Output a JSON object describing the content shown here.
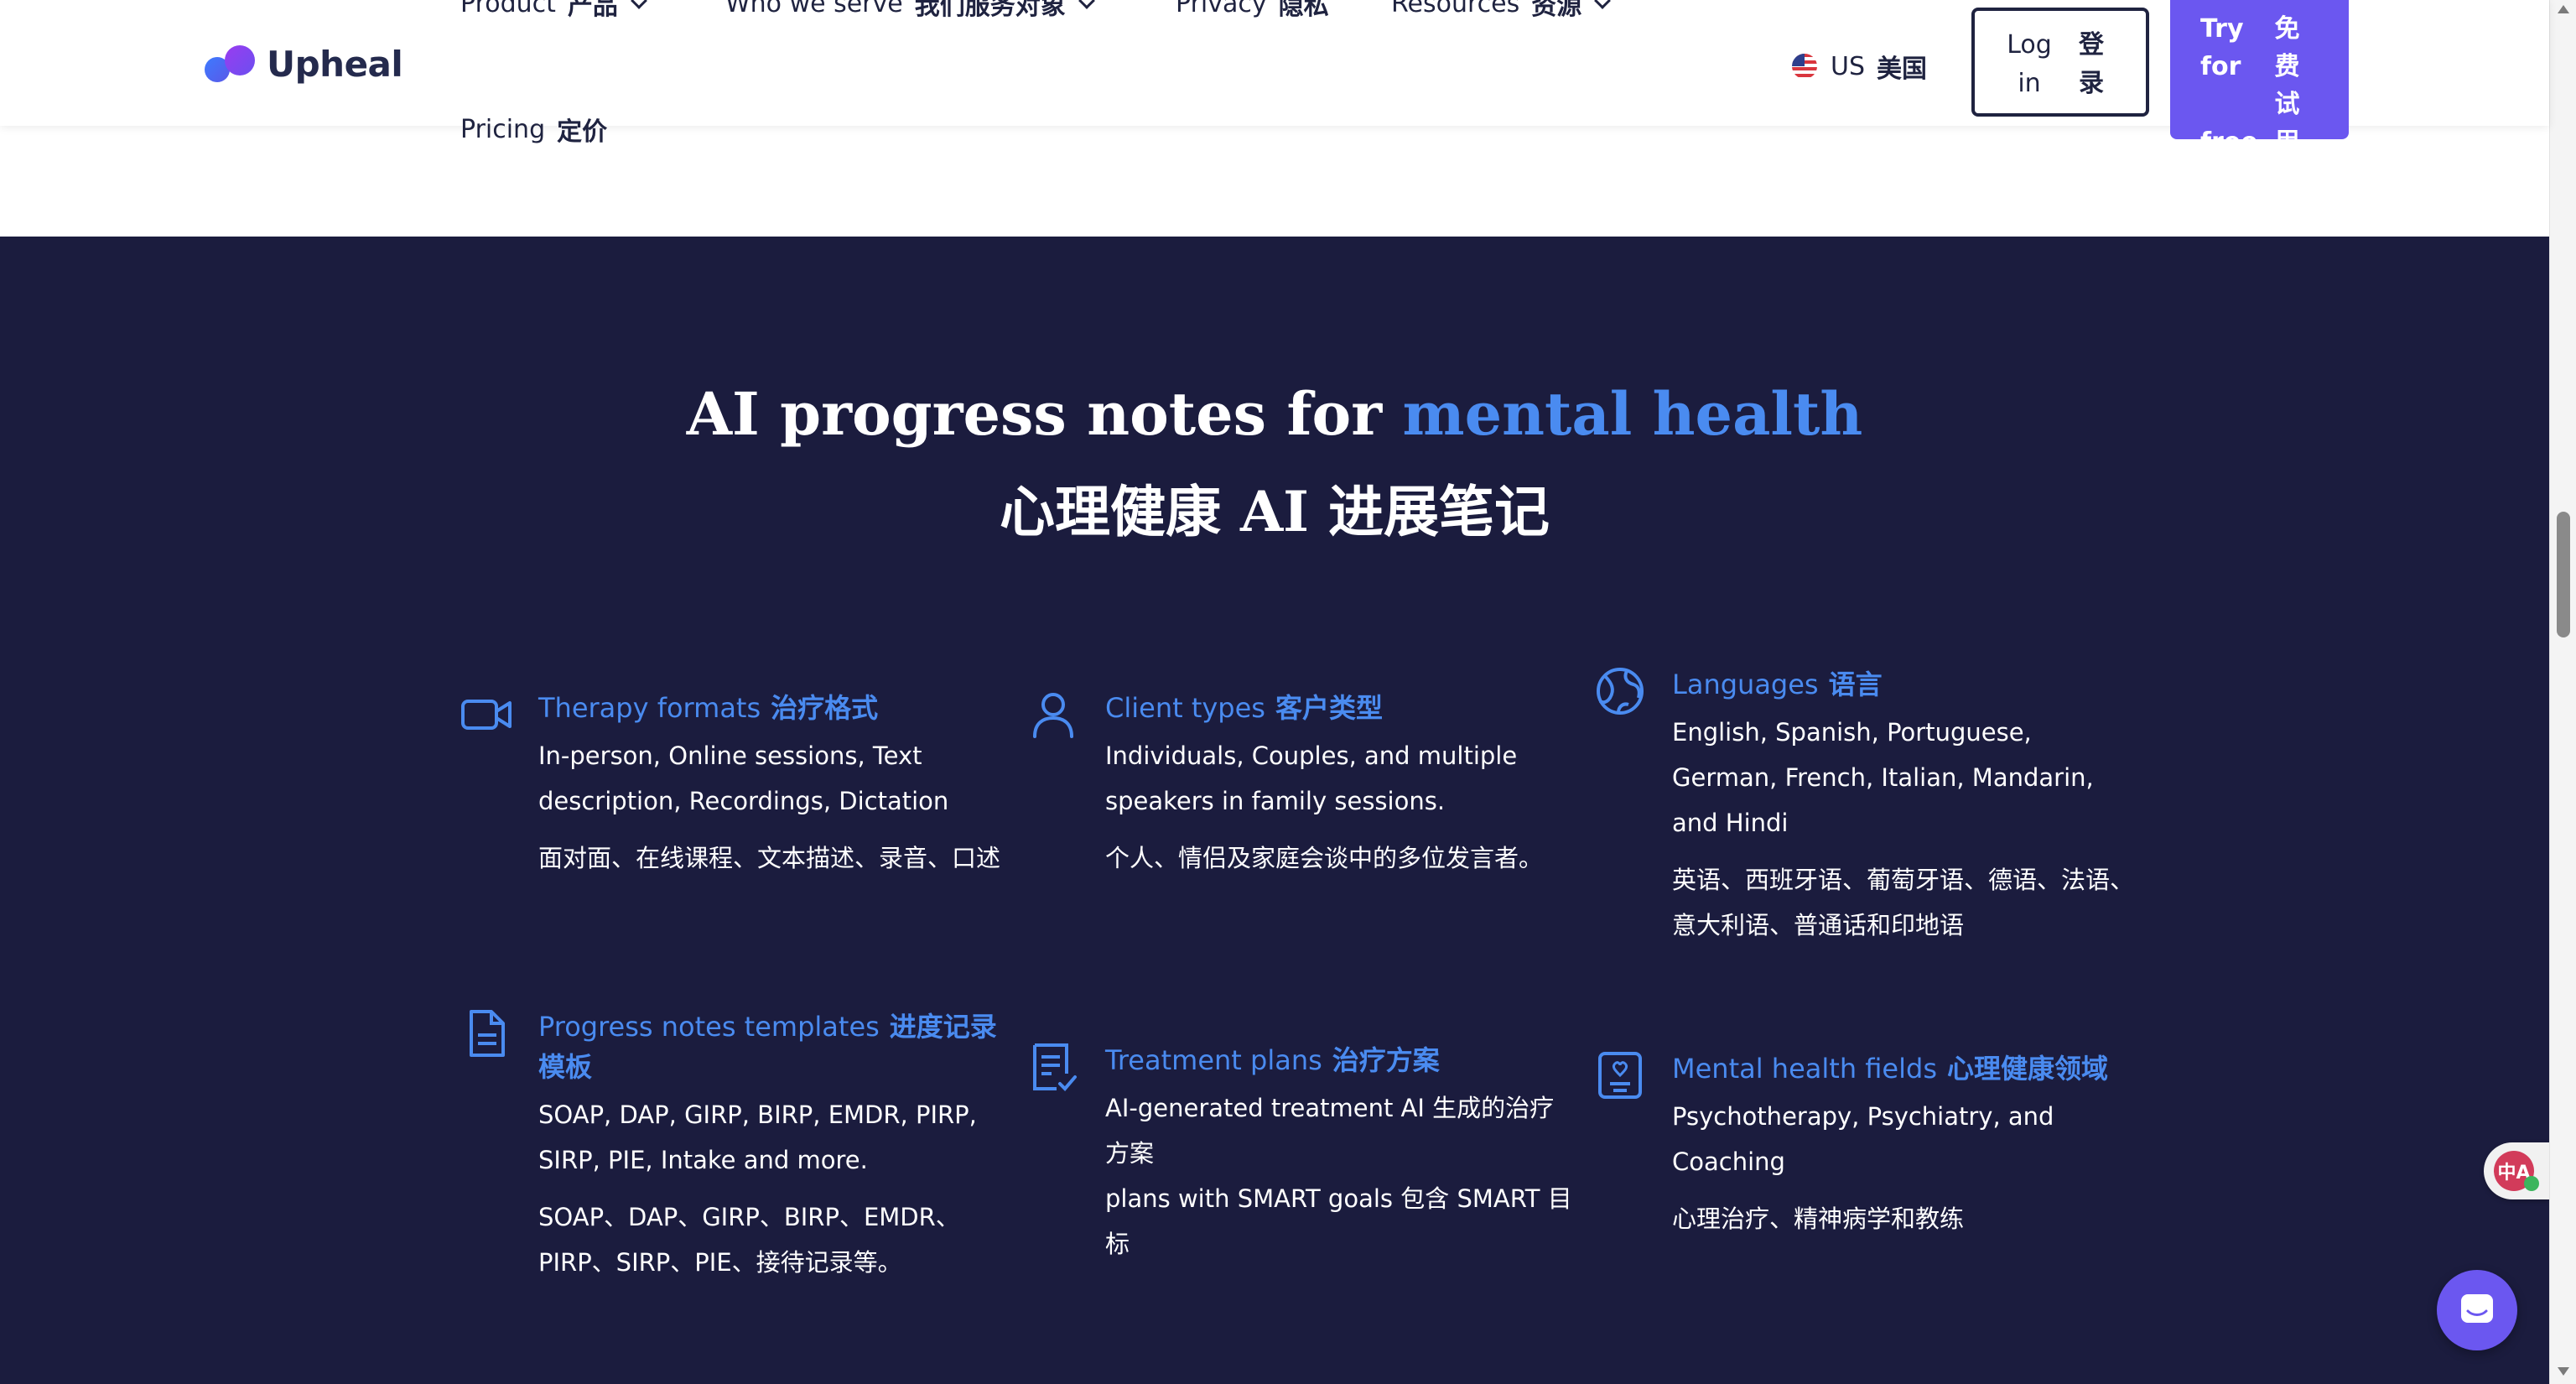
{
  "brand": {
    "name": "Upheal"
  },
  "nav": {
    "items": [
      {
        "en": "Product",
        "zh": "产品",
        "has_dropdown": true
      },
      {
        "en": "Who we serve",
        "zh": "我们服务对象",
        "has_dropdown": true
      },
      {
        "en": "Privacy",
        "zh": "隐私",
        "has_dropdown": false
      },
      {
        "en": "Resources",
        "zh": "资源",
        "has_dropdown": true
      },
      {
        "en": "Pricing",
        "zh": "定价",
        "has_dropdown": false
      }
    ],
    "locale": {
      "code": "US",
      "zh": "美国"
    },
    "login": {
      "en1": "Log",
      "zh1": "登",
      "en2": "in",
      "zh2": "录"
    },
    "try_free": {
      "en1": "Try",
      "zh1": "免",
      "en2": "for",
      "zh2": "费试",
      "en3": "free",
      "zh3": "用"
    }
  },
  "section": {
    "title_en_prefix": "AI progress notes for ",
    "title_en_accent": "mental health",
    "title_zh": "心理健康 AI 进展笔记",
    "features": [
      {
        "icon": "video-camera-icon",
        "title_en": "Therapy formats",
        "title_zh": "治疗格式",
        "desc_en": "In-person, Online sessions, Text description, Recordings, Dictation",
        "desc_zh": "面对面、在线课程、文本描述、录音、口述"
      },
      {
        "icon": "user-icon",
        "title_en": "Client types",
        "title_zh": "客户类型",
        "desc_en": "Individuals, Couples, and multiple speakers in family sessions.",
        "desc_zh": "个人、情侣及家庭会谈中的多位发言者。"
      },
      {
        "icon": "globe-icon",
        "title_en": "Languages",
        "title_zh": "语言",
        "desc_en": "English, Spanish, Portuguese, German, French, Italian, Mandarin, and Hindi",
        "desc_zh": "英语、西班牙语、葡萄牙语、德语、法语、意大利语、普通话和印地语"
      },
      {
        "icon": "document-icon",
        "title_en": "Progress notes templates",
        "title_zh": "进度记录模板",
        "desc_en": "SOAP,  DAP, GIRP, BIRP, EMDR, PIRP, SIRP, PIE, Intake and more.",
        "desc_zh": "SOAP、DAP、GIRP、BIRP、EMDR、PIRP、SIRP、PIE、接待记录等。"
      },
      {
        "icon": "checklist-icon",
        "title_en": "Treatment plans",
        "title_zh": "治疗方案",
        "desc_en": "AI-generated treatment  AI 生成的治疗方案",
        "desc_zh": "plans with SMART goals  包含 SMART 目标"
      },
      {
        "icon": "heart-profile-icon",
        "title_en": "Mental health fields",
        "title_zh": "心理健康领域",
        "desc_en": "Psychotherapy, Psychiatry, and Coaching",
        "desc_zh": "心理治疗、精神病学和教练"
      }
    ]
  },
  "widgets": {
    "translate_label": "中A"
  },
  "colors": {
    "accent": "#4a8bf0",
    "dark_bg": "#1b1c3e",
    "cta": "#6b57f0"
  }
}
